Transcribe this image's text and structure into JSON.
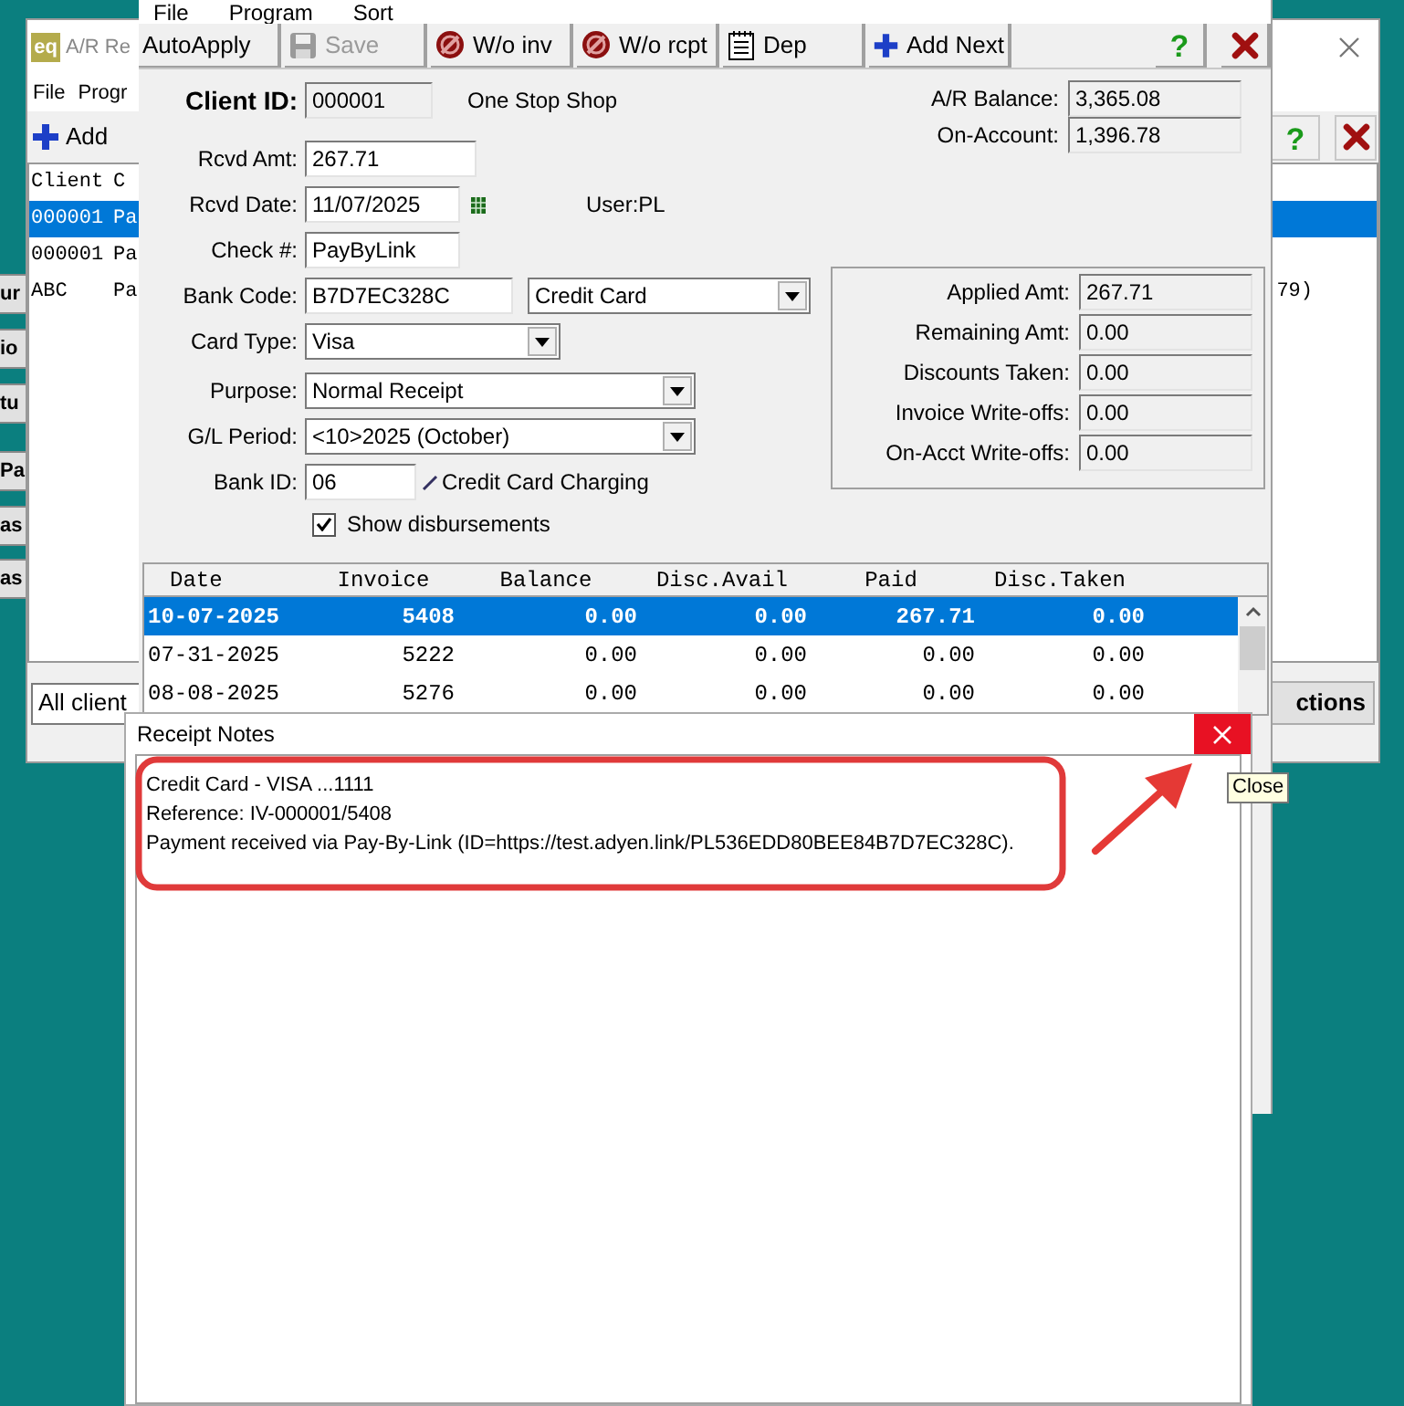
{
  "side_window": {
    "buttons": [
      "ur",
      "io",
      "tu",
      "Pa",
      "as",
      "as"
    ]
  },
  "back_window": {
    "logo": "eq",
    "title": "A/R Re",
    "menu": [
      "File",
      "Progr"
    ],
    "toolbar": {
      "add": "Add",
      "help": "?"
    },
    "list": {
      "columns": [
        "Client",
        "C"
      ],
      "rows": [
        {
          "cells": [
            "000001",
            "Pa"
          ],
          "selected": true
        },
        {
          "cells": [
            "000001",
            "Pa"
          ],
          "selected": false
        },
        {
          "cells": [
            "ABC",
            "Pa"
          ],
          "tail": "79)",
          "selected": false
        }
      ]
    },
    "filter": "All client",
    "action_button": "ctions"
  },
  "receipt_window": {
    "menu": [
      "File",
      "Program",
      "Sort"
    ],
    "toolbar": [
      {
        "label": "AutoApply",
        "disabled": false
      },
      {
        "label": "Save",
        "disabled": true
      },
      {
        "label": "W/o inv",
        "disabled": false
      },
      {
        "label": "W/o rcpt",
        "disabled": false
      },
      {
        "label": "Dep",
        "disabled": false
      },
      {
        "label": "Add Next",
        "disabled": false
      }
    ],
    "help": "?",
    "client": {
      "label": "Client ID:",
      "id": "000001",
      "name": "One Stop Shop"
    },
    "balances": [
      {
        "label": "A/R Balance:",
        "value": "3,365.08"
      },
      {
        "label": "On-Account:",
        "value": "1,396.78"
      }
    ],
    "rcvd_amt": {
      "label": "Rcvd Amt:",
      "value": "267.71"
    },
    "rcvd_date": {
      "label": "Rcvd Date:",
      "value": "11/07/2025",
      "user": "User:PL"
    },
    "check": {
      "label": "Check #:",
      "value": "PayByLink"
    },
    "bank_code": {
      "label": "Bank Code:",
      "value": "B7D7EC328C",
      "method": "Credit Card"
    },
    "card_type": {
      "label": "Card Type:",
      "value": "Visa"
    },
    "purpose": {
      "label": "Purpose:",
      "value": "Normal Receipt"
    },
    "gl_period": {
      "label": "G/L Period:",
      "value": "<10>2025 (October)"
    },
    "bank_id": {
      "label": "Bank ID:",
      "value": "06",
      "name": "Credit Card Charging"
    },
    "show_disbursements": {
      "label": "Show disbursements",
      "checked": true
    },
    "totals": [
      {
        "label": "Applied Amt:",
        "value": "267.71"
      },
      {
        "label": "Remaining Amt:",
        "value": "0.00"
      },
      {
        "label": "Discounts Taken:",
        "value": "0.00"
      },
      {
        "label": "Invoice Write-offs:",
        "value": "0.00"
      },
      {
        "label": "On-Acct Write-offs:",
        "value": "0.00"
      }
    ],
    "table": {
      "columns": [
        "Date",
        "Invoice",
        "Balance",
        "Disc.Avail",
        "Paid",
        "Disc.Taken"
      ],
      "rows": [
        {
          "cells": [
            "10-07-2025",
            "5408",
            "0.00",
            "0.00",
            "267.71",
            "0.00"
          ],
          "selected": true
        },
        {
          "cells": [
            "07-31-2025",
            "5222",
            "0.00",
            "0.00",
            "0.00",
            "0.00"
          ],
          "selected": false
        },
        {
          "cells": [
            "08-08-2025",
            "5276",
            "0.00",
            "0.00",
            "0.00",
            "0.00"
          ],
          "selected": false
        }
      ]
    }
  },
  "notes_dialog": {
    "title": "Receipt Notes",
    "lines": [
      "Credit Card - VISA ...1111",
      "Reference: IV-000001/5408",
      "Payment received via Pay-By-Link (ID=https://test.adyen.link/PL536EDD80BEE84B7D7EC328C)."
    ],
    "tooltip": "Close"
  }
}
